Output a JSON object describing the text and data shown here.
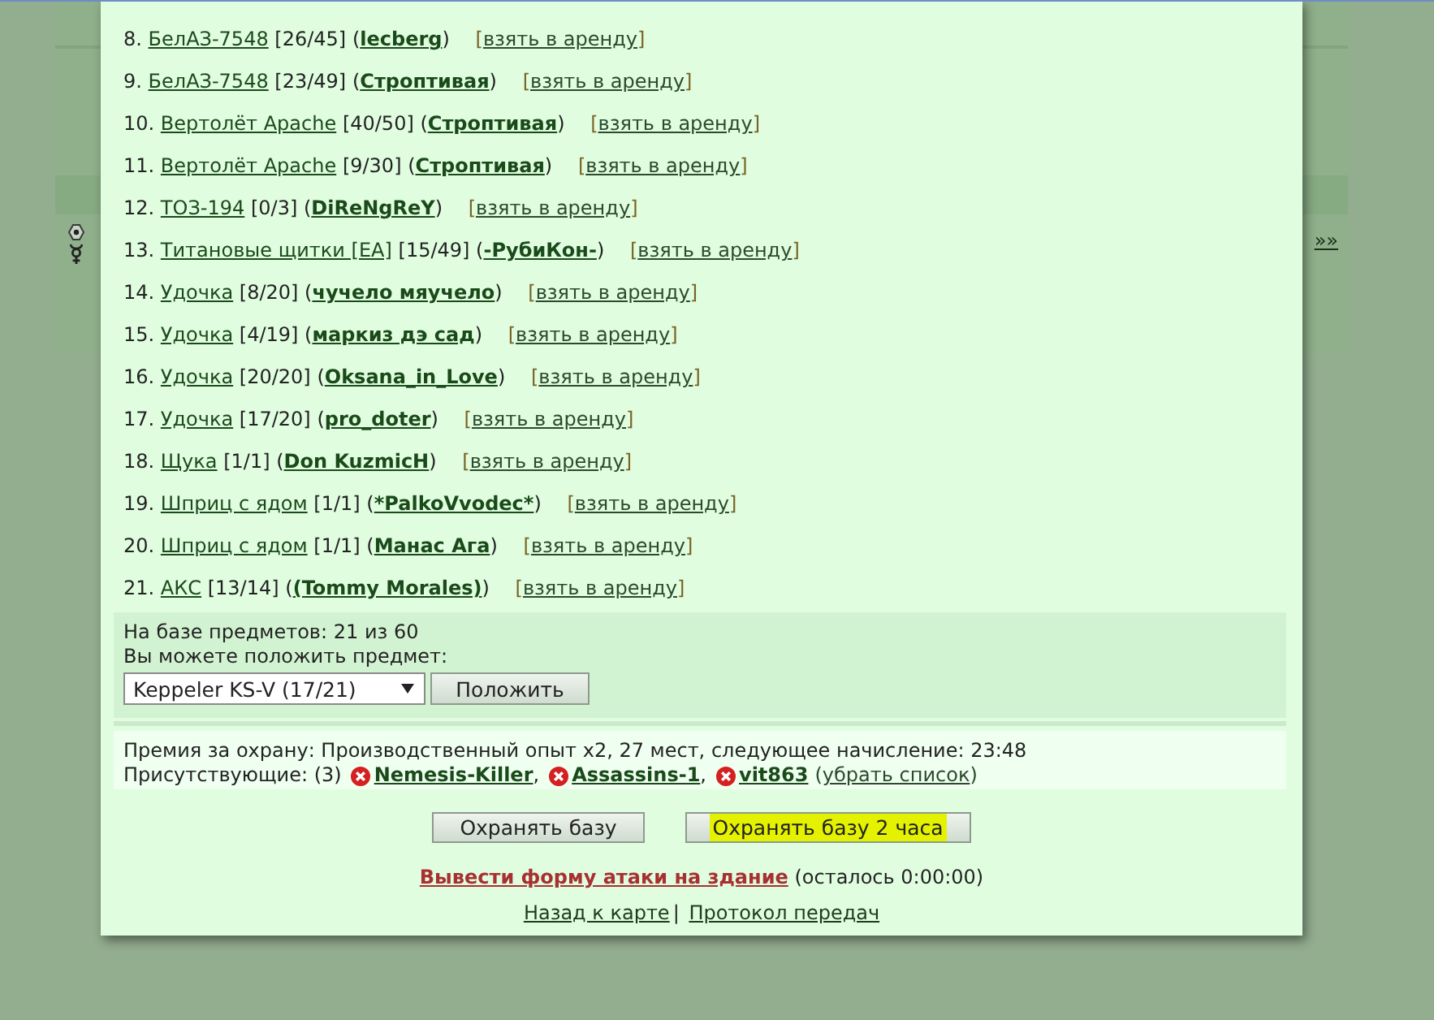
{
  "background_page": {
    "next_link": "»»"
  },
  "rentals": {
    "items": [
      {
        "number": "8.",
        "name": "БелАЗ-7548",
        "durability": "[26/45]",
        "owner": "(lecberg)",
        "action": "[взять в аренду]"
      },
      {
        "number": "9.",
        "name": "БелАЗ-7548",
        "durability": "[23/49]",
        "owner": "(Строптивая)",
        "action": "[взять в аренду]"
      },
      {
        "number": "10.",
        "name": "Вертолёт Apache",
        "durability": "[40/50]",
        "owner": "(Строптивая)",
        "action": "[взять в аренду]"
      },
      {
        "number": "11.",
        "name": "Вертолёт Apache",
        "durability": "[9/30]",
        "owner": "(Строптивая)",
        "action": "[взять в аренду]"
      },
      {
        "number": "12.",
        "name": "ТОЗ-194",
        "durability": "[0/3]",
        "owner": "(DiReNgReY)",
        "action": "[взять в аренду]"
      },
      {
        "number": "13.",
        "name": "Титановые щитки [ЕА]",
        "durability": "[15/49]",
        "owner": "(-РубиКон-)",
        "action": "[взять в аренду]"
      },
      {
        "number": "14.",
        "name": "Удочка",
        "durability": "[8/20]",
        "owner": "(чучело мяучело)",
        "action": "[взять в аренду]"
      },
      {
        "number": "15.",
        "name": "Удочка",
        "durability": "[4/19]",
        "owner": "(маркиз дэ сад)",
        "action": "[взять в аренду]"
      },
      {
        "number": "16.",
        "name": "Удочка",
        "durability": "[20/20]",
        "owner": "(Oksana_in_Love)",
        "action": "[взять в аренду]"
      },
      {
        "number": "17.",
        "name": "Удочка",
        "durability": "[17/20]",
        "owner": "(pro_doter)",
        "action": "[взять в аренду]"
      },
      {
        "number": "18.",
        "name": "Щука",
        "durability": "[1/1]",
        "owner": "(Don KuzmicH)",
        "action": "[взять в аренду]"
      },
      {
        "number": "19.",
        "name": "Шприц с ядом",
        "durability": "[1/1]",
        "owner": "(*PalkoVvodec*)",
        "action": "[взять в аренду]"
      },
      {
        "number": "20.",
        "name": "Шприц с ядом",
        "durability": "[1/1]",
        "owner": "(Манас Ага)",
        "action": "[взять в аренду]"
      },
      {
        "number": "21.",
        "name": "АКС",
        "durability": "[13/14]",
        "owner": "((Tommy Morales))",
        "action": "[взять в аренду]"
      }
    ]
  },
  "storage": {
    "count_text": "На базе предметов: 21 из 60",
    "put_label": "Вы можете положить предмет:",
    "selected_item": "Keppeler KS-V (17/21)",
    "put_button": "Положить"
  },
  "guard_info": {
    "reward": "Премия за охрану: Производственный опыт x2, 27 мест, следующее начисление: 23:48",
    "present_label": "Присутствующие: (3)",
    "players": [
      {
        "name": "Nemesis-Killer",
        "separator": ","
      },
      {
        "name": "Assassins-1",
        "separator": ","
      },
      {
        "name": "vit863"
      }
    ],
    "remove_list": "(убрать список)"
  },
  "buttons": [
    {
      "label": "Охранять базу",
      "highlighted": false
    },
    {
      "label": "Охранять базу 2 часа",
      "highlighted": true
    }
  ],
  "attack": {
    "link": "Вывести форму атаки на здание",
    "remaining": "(осталось 0:00:00)"
  },
  "footer": {
    "links": [
      "Назад к карте",
      "Протокол передач"
    ],
    "separator": "|"
  }
}
